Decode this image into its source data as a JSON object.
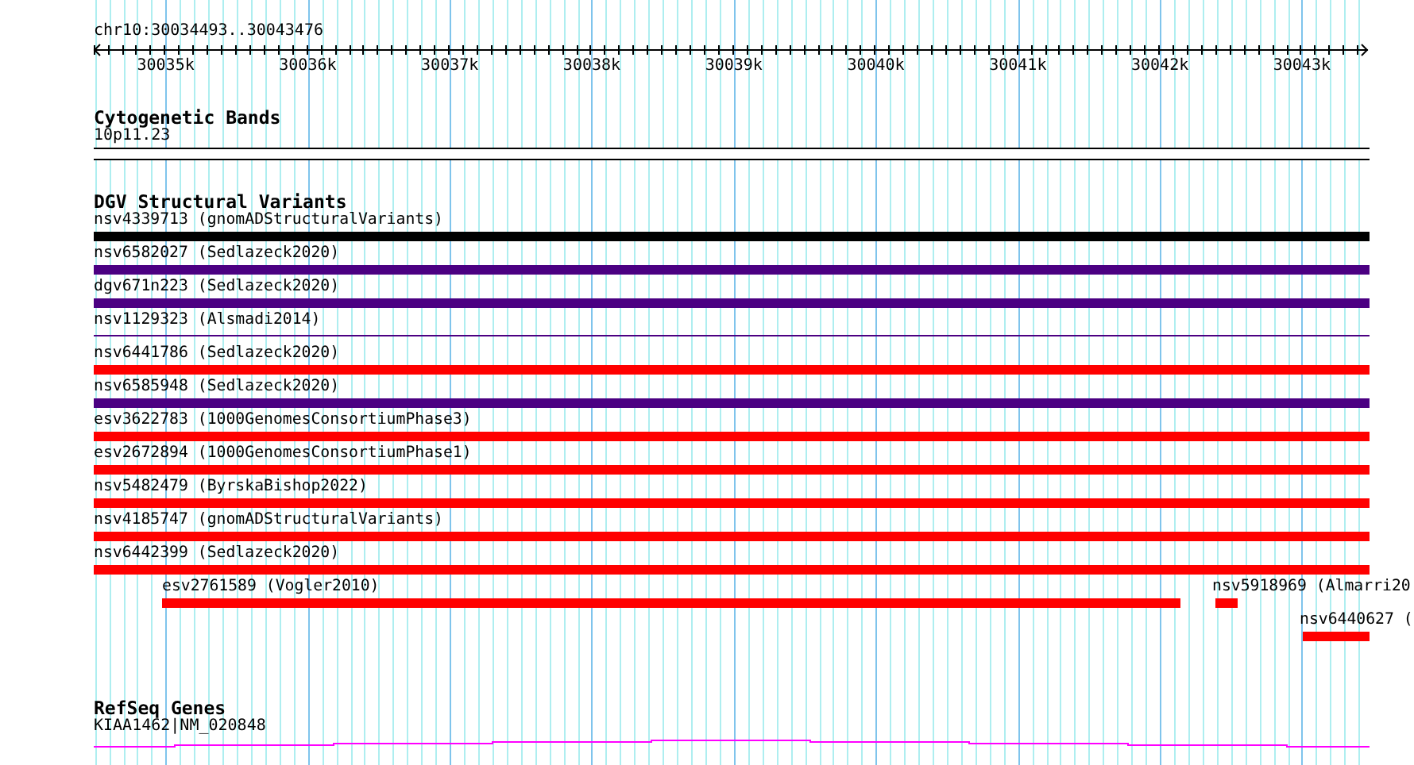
{
  "location": "chr10:30034493..30043476",
  "ruler": {
    "ticks": [
      "30035k",
      "30036k",
      "30037k",
      "30038k",
      "30039k",
      "30040k",
      "30041k",
      "30042k",
      "30043k"
    ]
  },
  "tracks": [
    {
      "kind": "cytoband",
      "title": "Cytogenetic Bands",
      "band": "10p11.23"
    },
    {
      "kind": "variants",
      "title": "DGV Structural Variants",
      "features": [
        {
          "label": "nsv4339713 (gnomADStructuralVariants)",
          "color": "#000000",
          "kind": "bar"
        },
        {
          "label": "nsv6582027 (Sedlazeck2020)",
          "color": "#4b0082",
          "kind": "bar"
        },
        {
          "label": "dgv671n223 (Sedlazeck2020)",
          "color": "#4b0082",
          "kind": "bar"
        },
        {
          "label": "nsv1129323 (Alsmadi2014)",
          "color": "#4b0082",
          "kind": "line"
        },
        {
          "label": "nsv6441786 (Sedlazeck2020)",
          "color": "#ff0000",
          "kind": "bar"
        },
        {
          "label": "nsv6585948 (Sedlazeck2020)",
          "color": "#4b0082",
          "kind": "bar"
        },
        {
          "label": "esv3622783 (1000GenomesConsortiumPhase3)",
          "color": "#ff0000",
          "kind": "bar"
        },
        {
          "label": "esv2672894 (1000GenomesConsortiumPhase1)",
          "color": "#ff0000",
          "kind": "bar"
        },
        {
          "label": "nsv5482479 (ByrskaBishop2022)",
          "color": "#ff0000",
          "kind": "bar"
        },
        {
          "label": "nsv4185747 (gnomADStructuralVariants)",
          "color": "#ff0000",
          "kind": "bar"
        },
        {
          "label": "nsv6442399 (Sedlazeck2020)",
          "color": "#ff0000",
          "kind": "bar"
        },
        {
          "label": "esv2761589 (Vogler2010)",
          "color": "#ff0000",
          "kind": "bar"
        },
        {
          "label": "nsv5918969 (Almarri20",
          "color": "#ff0000",
          "kind": "bar"
        },
        {
          "label": "nsv6440627 (",
          "color": "#ff0000",
          "kind": "bar"
        }
      ]
    },
    {
      "kind": "genes",
      "title": "RefSeq Genes",
      "genes": [
        {
          "label": "KIAA1462|NM_020848",
          "color": "#ff00ff"
        }
      ]
    }
  ]
}
